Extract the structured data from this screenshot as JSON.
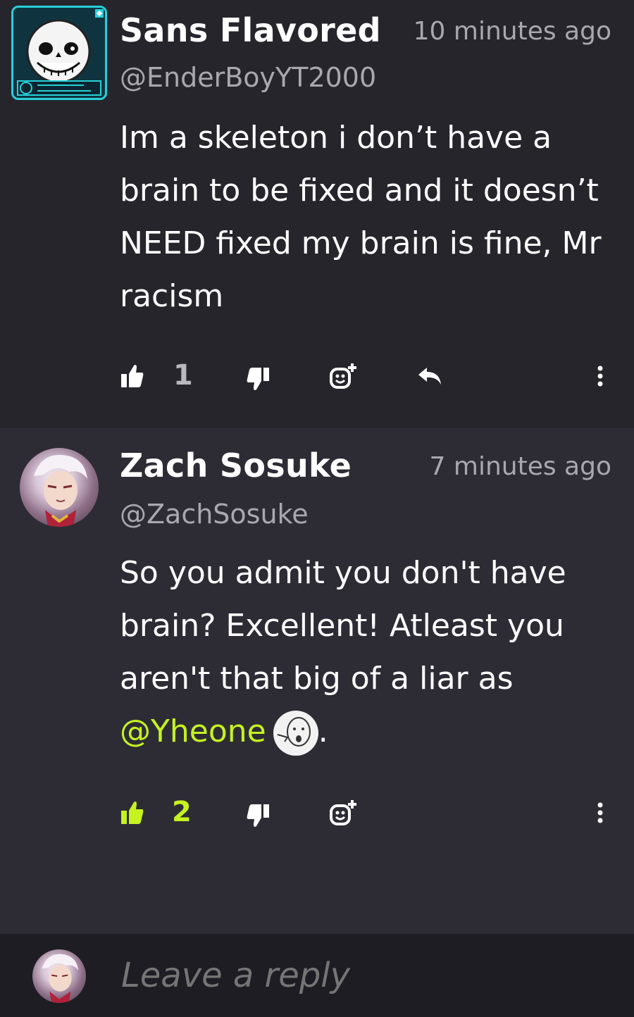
{
  "comments": [
    {
      "author": "Sans Flavored",
      "handle": "@EnderBoyYT2000",
      "time": "10 minutes ago",
      "text": "Im a skeleton i don’t have a brain to be fixed and it doesn’t NEED fixed my brain is fine, Mr racism",
      "likes": "1",
      "liked": false,
      "avatar_icon": "skeleton-avatar"
    },
    {
      "author": "Zach Sosuke",
      "handle": "@ZachSosuke",
      "time": "7 minutes ago",
      "text_before_mention": "So you admit you don't have brain? Excellent! Atleast you aren't that big of a liar as ",
      "mention": "@Yheone",
      "text_after_mention": ".",
      "likes": "2",
      "liked": true,
      "avatar_icon": "anime-avatar"
    }
  ],
  "reply": {
    "placeholder": "Leave a reply"
  },
  "colors": {
    "accent": "#c6f21f",
    "background": "#26252c",
    "highlighted_comment": "#2d2c35",
    "muted_text": "#a9a8af"
  }
}
